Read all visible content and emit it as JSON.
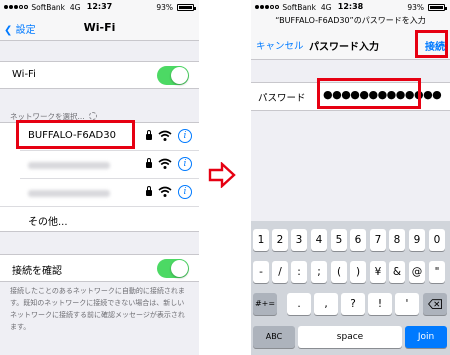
{
  "left": {
    "status": {
      "carrier": "SoftBank",
      "network": "4G",
      "time": "12:37",
      "battery": "93%"
    },
    "nav": {
      "back_label": "設定",
      "title": "Wi-Fi"
    },
    "wifi_label": "Wi-Fi",
    "section_header": "ネットワークを選択...",
    "networks": [
      {
        "name": "BUFFALO-F6AD30",
        "secured": true,
        "highlighted": true
      },
      {
        "name": "",
        "secured": true,
        "blurred": true
      },
      {
        "name": "",
        "secured": true,
        "blurred": true
      }
    ],
    "other_label": "その他...",
    "ask_join_label": "接続を確認",
    "description": "接続したことのあるネットワークに自動的に接続されます。既知のネットワークに接続できない場合は、新しいネットワークに接続する前に確認メッセージが表示されます。",
    "accent": "#007aff",
    "toggle_color": "#4cd964",
    "highlight_color": "#e60012"
  },
  "right": {
    "status": {
      "carrier": "SoftBank",
      "network": "4G",
      "time": "12:38",
      "battery": "93%"
    },
    "prompt": "“BUFFALO-F6AD30”のパスワードを入力",
    "nav": {
      "cancel_label": "キャンセル",
      "title": "パスワード入力",
      "connect_label": "接続"
    },
    "password_label": "パスワード",
    "password_value": "●●●●●●●●●●●●●",
    "keyboard": {
      "row1": [
        "1",
        "2",
        "3",
        "4",
        "5",
        "6",
        "7",
        "8",
        "9",
        "0"
      ],
      "row2": [
        "-",
        "/",
        ":",
        ";",
        "(",
        ")",
        "¥",
        "&",
        "@",
        "\""
      ],
      "row3_left": "#+=",
      "row3": [
        ".",
        ",",
        "?",
        "!",
        "'"
      ],
      "row3_right": "delete-icon",
      "abc": "ABC",
      "space": "space",
      "join": "Join"
    }
  }
}
